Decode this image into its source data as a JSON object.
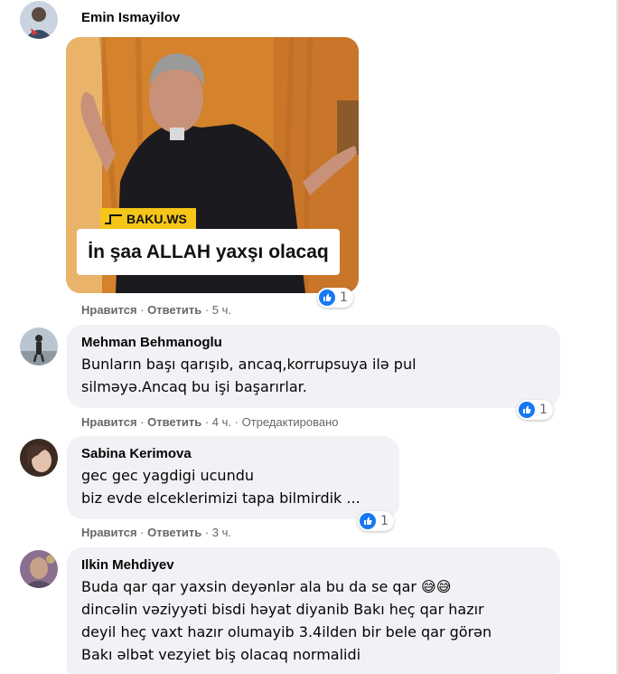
{
  "actions": {
    "like_label": "Нравится",
    "reply_label": "Ответить",
    "separator": " · "
  },
  "comments": [
    {
      "author": "Emin Ismayilov",
      "time": "5 ч.",
      "edited": "",
      "reaction_count": "1",
      "image": {
        "brand": "BAKU.WS",
        "caption": "İn şaa ALLAH yaxşı olacaq"
      }
    },
    {
      "author": "Mehman Behmanoglu",
      "text": "Bunların başı qarışıb, ancaq,korrupsuya ilə pul\nsilməyə.Ancaq bu işi başarırlar.",
      "time": "4 ч.",
      "edited": "Отредактировано",
      "reaction_count": "1"
    },
    {
      "author": "Sabina Kerimova",
      "text": "gec gec yagdigi ucundu\nbiz evde elceklerimizi tapa bilmirdik ...",
      "time": "3 ч.",
      "edited": "",
      "reaction_count": "1"
    },
    {
      "author": "Ilkin Mehdiyev",
      "text": "Buda qar qar yaxsin deyənlər ala bu da se qar 😅😅\ndincəlin vəziyyəti bisdi həyat diyanib Bakı heç qar hazır\ndeyil heç vaxt hazır olumayib 3.4ilden bir bele qar görən\nBakı əlbət vezyiet biş olacaq normalidi"
    }
  ],
  "colors": {
    "bubble_bg": "#f0f2f5",
    "like_blue": "#1877f2",
    "meta_gray": "#65676b",
    "brand_yellow": "#f5c518"
  }
}
